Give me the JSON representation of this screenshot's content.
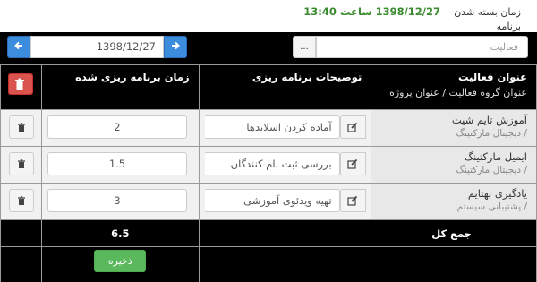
{
  "header": {
    "closing_label": "زمان بسته شدن برنامه",
    "closing_time": "1398/12/27 ساعت 13:40"
  },
  "filters": {
    "date_value": "1398/12/27",
    "activity_placeholder": "فعالیت",
    "dots_label": "..."
  },
  "table": {
    "col_title": "عنوان فعالیت",
    "col_title_sub": "عنوان گروه فعالیت  /  عنوان پروژه",
    "col_desc": "توضیحات برنامه ریزی",
    "col_time": "زمان برنامه ریزی شده",
    "rows": [
      {
        "title": "آموزش تایم شیت",
        "group": "/ دیجیتال مارکتینگ",
        "desc": "آماده کردن اسلایدها",
        "time": "2"
      },
      {
        "title": "ایمیل مارکتینگ",
        "group": "/ دیجیتال مارکتینگ",
        "desc": "بررسی ثبت نام کنندگان",
        "time": "1.5"
      },
      {
        "title": "یادگیری بهتایم",
        "group": "/ پشتیبانی سیستم",
        "desc": "تهیه ویدئوی آموزشی",
        "time": "3"
      }
    ],
    "total_label": "جمع کل",
    "total_value": "6.5",
    "save_label": "ذخیره"
  },
  "icons": {
    "prev": "arrow-left-icon",
    "next": "arrow-right-icon",
    "edit": "pencil-icon",
    "trash": "trash-icon"
  },
  "colors": {
    "accent_blue": "#3c8dde",
    "danger_red": "#d9534f",
    "success_green": "#5cb85c",
    "time_green": "#3a8a2e"
  }
}
